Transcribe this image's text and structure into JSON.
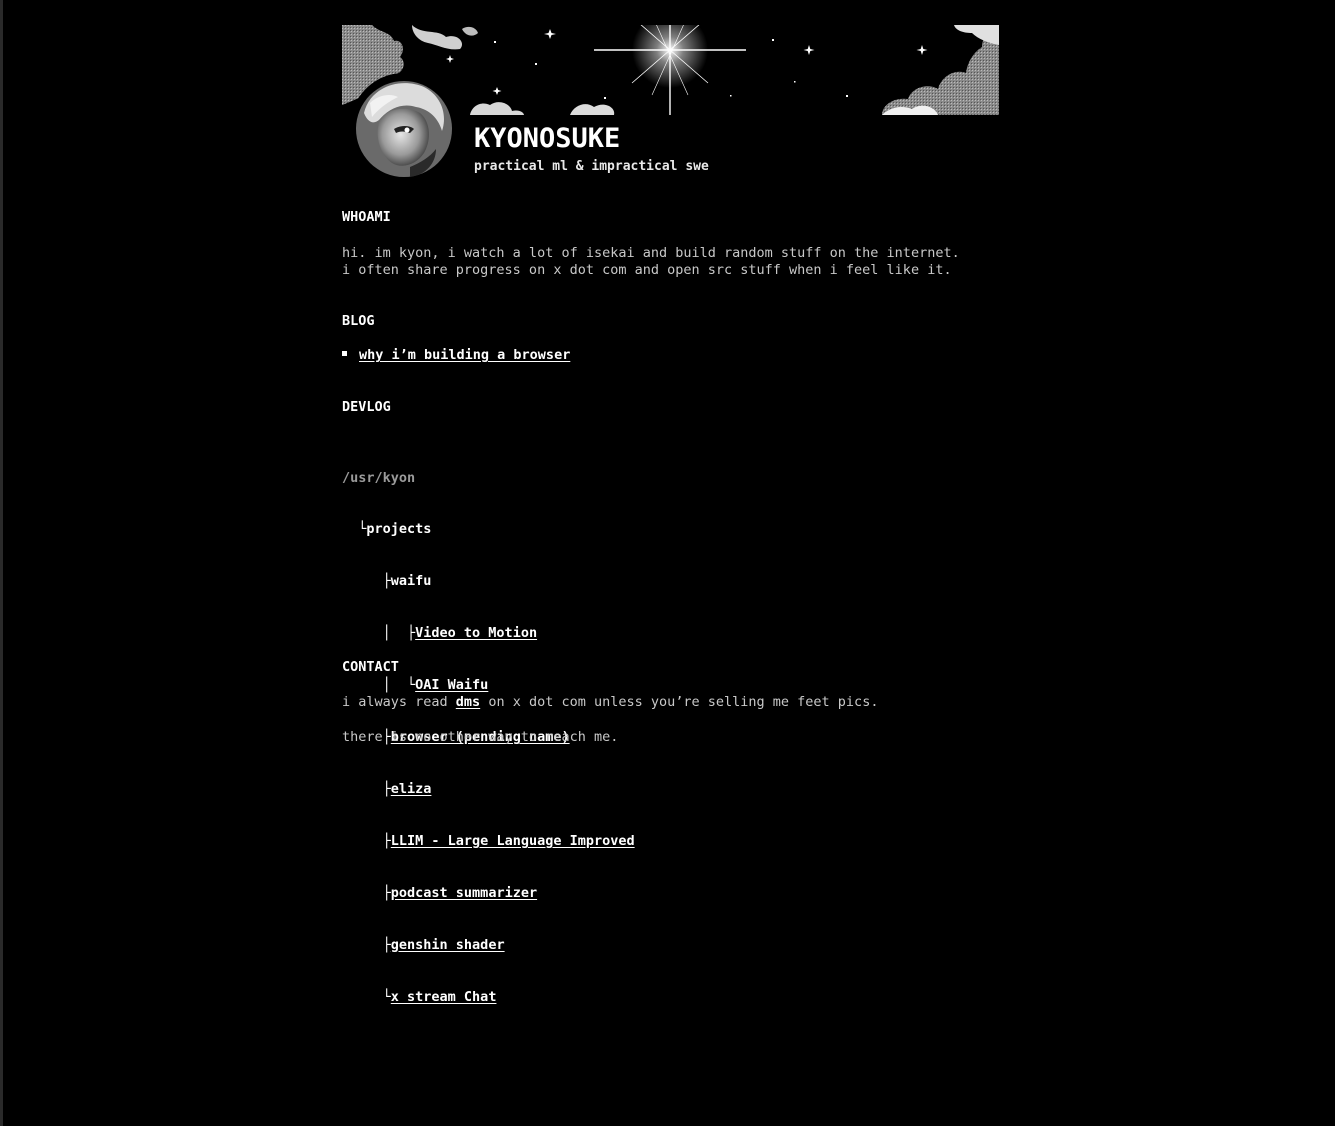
{
  "header": {
    "title": "KYONOSUKE",
    "tagline": "practical ml & impractical swe"
  },
  "icons": {
    "banner": "starry-sky-clouds-banner",
    "avatar": "anime-character-avatar"
  },
  "whoami": {
    "heading": "WHOAMI",
    "line1": "hi. im kyon, i watch a lot of isekai and build random stuff on the internet.",
    "line2": "i often share progress on x dot com and open src stuff when i feel like it."
  },
  "blog": {
    "heading": "BLOG",
    "posts": [
      {
        "label": "why i’m building a browser"
      }
    ]
  },
  "devlog": {
    "heading": "DEVLOG",
    "root": "/usr/kyon",
    "folder": "projects",
    "group": "waifu",
    "group_items": [
      {
        "label": "Video to Motion"
      },
      {
        "label": "OAI Waifu"
      }
    ],
    "items": [
      {
        "label": "browser (pending name)"
      },
      {
        "label": "eliza"
      },
      {
        "label": "LLIM - Large Language Improved"
      },
      {
        "label": "podcast summarizer"
      },
      {
        "label": "genshin shader"
      },
      {
        "label": "x stream Chat"
      }
    ]
  },
  "contact": {
    "heading": "CONTACT",
    "line1_pre": "i always read ",
    "line1_link": "dms",
    "line1_post": " on x dot com unless you’re selling me feet pics.",
    "line2": "there is no other way to reach me."
  },
  "colors": {
    "background": "#000000",
    "text": "#c8c8c8",
    "heading": "#ffffff",
    "link": "#ffffff"
  }
}
